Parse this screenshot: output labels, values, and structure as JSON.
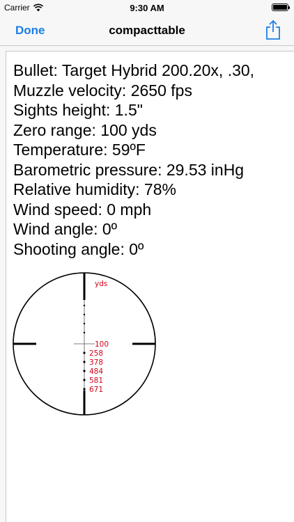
{
  "status": {
    "carrier": "Carrier",
    "time": "9:30 AM",
    "battery_level": 1.0
  },
  "nav": {
    "done_label": "Done",
    "title": "compacttable"
  },
  "info": [
    "Bullet: Target Hybrid 200.20x, .30,",
    "Muzzle velocity: 2650 fps",
    "Sights height: 1.5\"",
    "Zero range: 100 yds",
    "Temperature: 59ºF",
    "Barometric pressure: 29.53 inHg",
    "Relative humidity: 78%",
    "Wind speed: 0 mph",
    "Wind angle: 0º",
    "Shooting angle: 0º"
  ],
  "reticle": {
    "unit_label": "yds",
    "zero_label": "100",
    "ranges": [
      "258",
      "378",
      "484",
      "581",
      "671"
    ],
    "label_color": "#d0021b"
  }
}
